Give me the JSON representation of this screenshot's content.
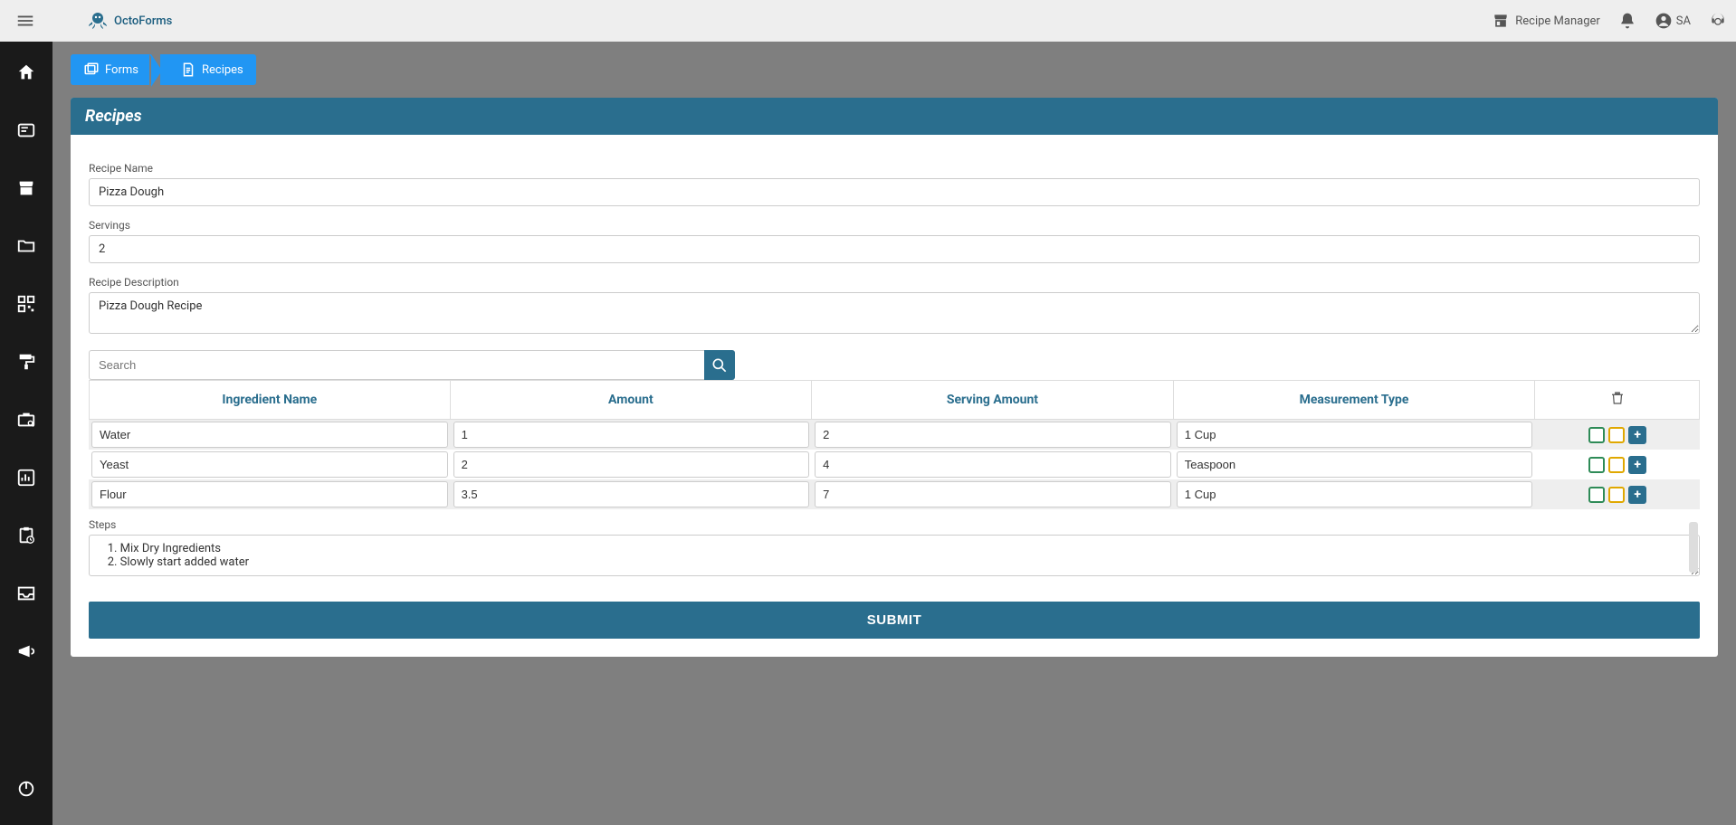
{
  "app": {
    "name": "OctoForms"
  },
  "appbar": {
    "workspace_label": "Recipe Manager",
    "user_label": "SA"
  },
  "breadcrumb": [
    {
      "label": "Forms"
    },
    {
      "label": "Recipes"
    }
  ],
  "page": {
    "title": "Recipes"
  },
  "form": {
    "recipe_name": {
      "label": "Recipe Name",
      "value": "Pizza Dough"
    },
    "servings": {
      "label": "Servings",
      "value": "2"
    },
    "description": {
      "label": "Recipe Description",
      "value": "Pizza Dough Recipe"
    },
    "steps": {
      "label": "Steps",
      "value": "   1. Mix Dry Ingredients\n   2. Slowly start added water"
    }
  },
  "search": {
    "placeholder": "Search"
  },
  "ingredients": {
    "columns": [
      "Ingredient Name",
      "Amount",
      "Serving Amount",
      "Measurement Type"
    ],
    "rows": [
      {
        "name": "Water",
        "amount": "1",
        "serving": "2",
        "measure": "1 Cup"
      },
      {
        "name": "Yeast",
        "amount": "2",
        "serving": "4",
        "measure": "Teaspoon"
      },
      {
        "name": "Flour",
        "amount": "3.5",
        "serving": "7",
        "measure": "1 Cup"
      }
    ]
  },
  "buttons": {
    "submit": "SUBMIT"
  }
}
